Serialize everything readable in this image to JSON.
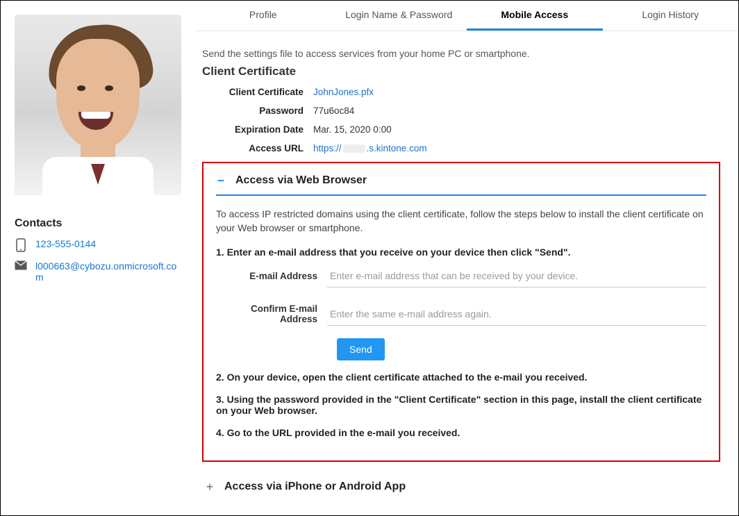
{
  "sidebar": {
    "contacts_heading": "Contacts",
    "phone": "123-555-0144",
    "email": "l000663@cybozu.onmicrosoft.com"
  },
  "tabs": [
    {
      "label": "Profile"
    },
    {
      "label": "Login Name & Password"
    },
    {
      "label": "Mobile Access"
    },
    {
      "label": "Login History"
    }
  ],
  "intro": "Send the settings file to access services from your home PC or smartphone.",
  "client_cert": {
    "heading": "Client Certificate",
    "rows": {
      "cert_label": "Client Certificate",
      "cert_value": "JohnJones.pfx",
      "password_label": "Password",
      "password_value": "77u6oc84",
      "exp_label": "Expiration Date",
      "exp_value": "Mar. 15, 2020 0:00",
      "url_label": "Access URL",
      "url_prefix": "https://",
      "url_suffix": ".s.kintone.com"
    }
  },
  "browser_panel": {
    "collapse_sign": "–",
    "title": "Access via Web Browser",
    "desc": "To access IP restricted domains using the client certificate, follow the steps below to install the client certificate on your Web browser or smartphone.",
    "step1": "1. Enter an e-mail address that you receive on your device then click \"Send\".",
    "email_label": "E-mail Address",
    "email_placeholder": "Enter e-mail address that can be received by your device.",
    "confirm_label": "Confirm E-mail Address",
    "confirm_placeholder": "Enter the same e-mail address again.",
    "send_label": "Send",
    "step2": "2. On your device, open the client certificate attached to the e-mail you received.",
    "step3": "3. Using the password provided in the \"Client Certificate\" section in this page, install the client certificate on your Web browser.",
    "step4": "4. Go to the URL provided in the e-mail you received."
  },
  "app_panel": {
    "collapse_sign": "+",
    "title": "Access via iPhone or Android App"
  }
}
